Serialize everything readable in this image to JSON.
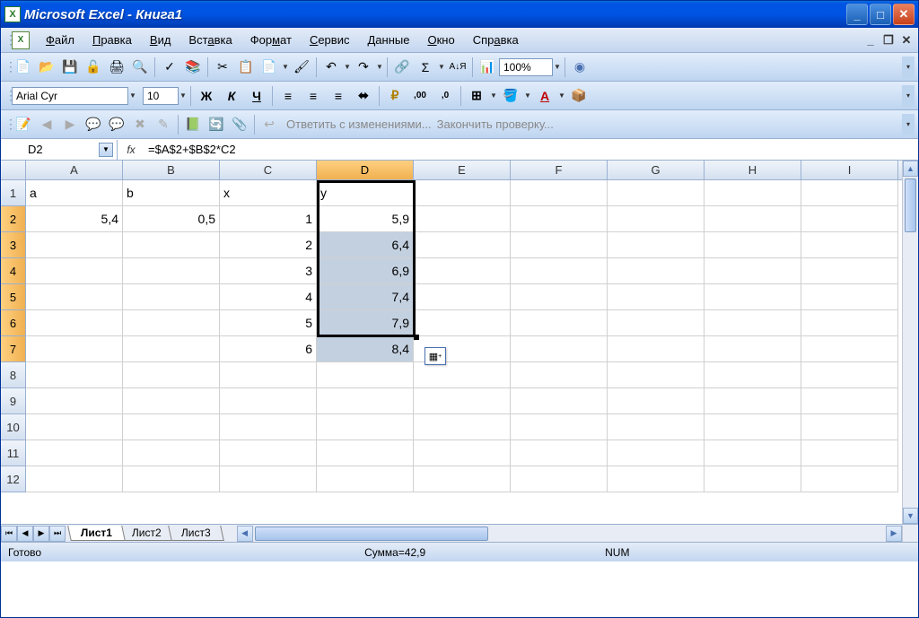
{
  "title": "Microsoft Excel - Книга1",
  "menu": {
    "file": "Файл",
    "edit": "Правка",
    "view": "Вид",
    "insert": "Вставка",
    "format": "Формат",
    "service": "Сервис",
    "data": "Данные",
    "window": "Окно",
    "help": "Справка"
  },
  "toolbar": {
    "zoom": "100%"
  },
  "fmtbar": {
    "font": "Arial Cyr",
    "size": "10"
  },
  "review": {
    "reply": "Ответить с изменениями...",
    "end": "Закончить проверку..."
  },
  "formulabar": {
    "cellref": "D2",
    "fx": "fx",
    "formula": "=$A$2+$B$2*C2"
  },
  "columns": [
    "A",
    "B",
    "C",
    "D",
    "E",
    "F",
    "G",
    "H",
    "I"
  ],
  "rows": [
    1,
    2,
    3,
    4,
    5,
    6,
    7,
    8,
    9,
    10,
    11,
    12
  ],
  "cells": {
    "A1": "a",
    "B1": "b",
    "C1": "x",
    "D1": "y",
    "A2": "5,4",
    "B2": "0,5",
    "C2": "1",
    "C3": "2",
    "C4": "3",
    "C5": "4",
    "C6": "5",
    "C7": "6",
    "D2": "5,9",
    "D3": "6,4",
    "D4": "6,9",
    "D5": "7,4",
    "D6": "7,9",
    "D7": "8,4"
  },
  "selection": {
    "active": "D2",
    "range": "D2:D7",
    "col": "D",
    "rows": [
      2,
      3,
      4,
      5,
      6,
      7
    ]
  },
  "tabs": {
    "t1": "Лист1",
    "t2": "Лист2",
    "t3": "Лист3",
    "active": 1
  },
  "status": {
    "ready": "Готово",
    "sum": "Сумма=42,9",
    "num": "NUM"
  }
}
